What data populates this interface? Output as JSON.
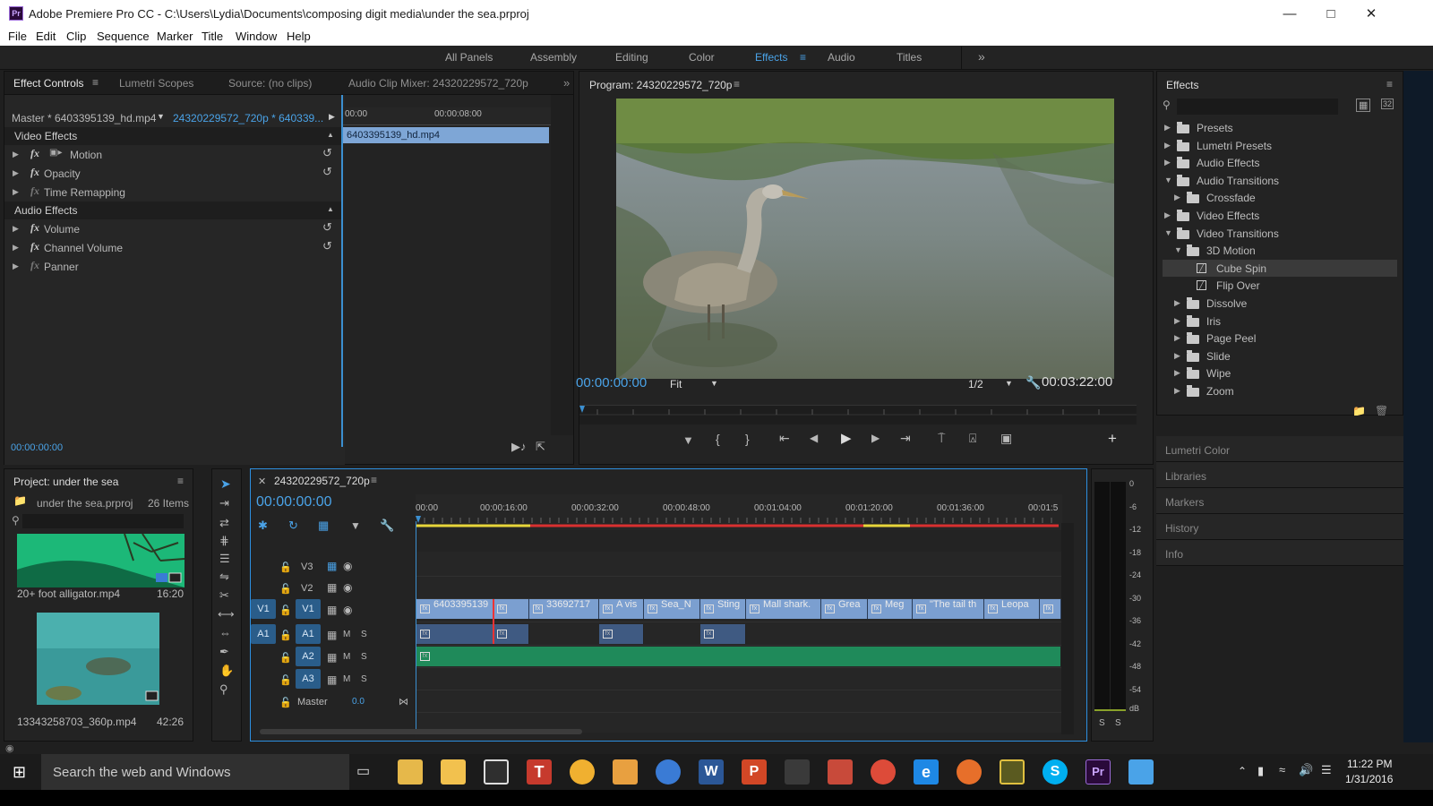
{
  "window": {
    "app_icon": "Pr",
    "title": "Adobe Premiere Pro CC - C:\\Users\\Lydia\\Documents\\composing digit media\\under the sea.prproj",
    "controls": [
      "minimize-icon",
      "maximize-icon",
      "close-icon"
    ]
  },
  "menu": [
    "File",
    "Edit",
    "Clip",
    "Sequence",
    "Marker",
    "Title",
    "Window",
    "Help"
  ],
  "workspaces": {
    "items": [
      "All Panels",
      "Assembly",
      "Editing",
      "Color",
      "Effects",
      "Audio",
      "Titles"
    ],
    "active": "Effects",
    "overflow": "»",
    "menu": "≡"
  },
  "effect_controls": {
    "tabs": [
      "Effect Controls",
      "Lumetri Scopes",
      "Source: (no clips)",
      "Audio Clip Mixer: 24320229572_720p"
    ],
    "overflow": "»",
    "master_label": "Master * 6403395139_hd.mp4",
    "sequence_label": "24320229572_720p * 640339...",
    "ruler": [
      "00:00",
      "00:00:08:00"
    ],
    "clip_bar": "6403395139_hd.mp4",
    "video_section": "Video Effects",
    "video_effects": [
      "Motion",
      "Opacity",
      "Time Remapping"
    ],
    "audio_section": "Audio Effects",
    "audio_effects": [
      "Volume",
      "Channel Volume",
      "Panner"
    ],
    "fx_glyph": "fx",
    "timecode": "00:00:00:00"
  },
  "program": {
    "title": "Program: 24320229572_720p",
    "timecode": "00:00:00:00",
    "zoom": "Fit",
    "resolution": "1/2",
    "duration": "00:03:22:00"
  },
  "effects_panel": {
    "title": "Effects",
    "tree": [
      {
        "label": "Presets",
        "level": 0,
        "expanded": false,
        "type": "star-folder"
      },
      {
        "label": "Lumetri Presets",
        "level": 0,
        "expanded": false,
        "type": "star-folder"
      },
      {
        "label": "Audio Effects",
        "level": 0,
        "expanded": false,
        "type": "folder"
      },
      {
        "label": "Audio Transitions",
        "level": 0,
        "expanded": true,
        "type": "folder"
      },
      {
        "label": "Crossfade",
        "level": 1,
        "expanded": false,
        "type": "folder"
      },
      {
        "label": "Video Effects",
        "level": 0,
        "expanded": false,
        "type": "folder"
      },
      {
        "label": "Video Transitions",
        "level": 0,
        "expanded": true,
        "type": "folder"
      },
      {
        "label": "3D Motion",
        "level": 1,
        "expanded": true,
        "type": "folder"
      },
      {
        "label": "Cube Spin",
        "level": 2,
        "type": "effect",
        "selected": true
      },
      {
        "label": "Flip Over",
        "level": 2,
        "type": "effect"
      },
      {
        "label": "Dissolve",
        "level": 1,
        "expanded": false,
        "type": "folder"
      },
      {
        "label": "Iris",
        "level": 1,
        "expanded": false,
        "type": "folder"
      },
      {
        "label": "Page Peel",
        "level": 1,
        "expanded": false,
        "type": "folder"
      },
      {
        "label": "Slide",
        "level": 1,
        "expanded": false,
        "type": "folder"
      },
      {
        "label": "Wipe",
        "level": 1,
        "expanded": false,
        "type": "folder"
      },
      {
        "label": "Zoom",
        "level": 1,
        "expanded": false,
        "type": "folder"
      }
    ],
    "collapsed_panels": [
      "Lumetri Color",
      "Libraries",
      "Markers",
      "History",
      "Info"
    ]
  },
  "project": {
    "title": "Project: under the sea",
    "file": "under the sea.prproj",
    "count": "26 Items",
    "items": [
      {
        "name": "20+ foot alligator.mp4",
        "duration": "16:20"
      },
      {
        "name": "13343258703_360p.mp4",
        "duration": "42:26"
      }
    ]
  },
  "timeline": {
    "sequence": "24320229572_720p",
    "timecode": "00:00:00:00",
    "ruler": [
      "00:00",
      "00:00:16:00",
      "00:00:32:00",
      "00:00:48:00",
      "00:01:04:00",
      "00:01:20:00",
      "00:01:36:00",
      "00:01:5"
    ],
    "tracks": {
      "video": [
        "V3",
        "V2",
        "V1"
      ],
      "audio": [
        "A1",
        "A2",
        "A3"
      ],
      "source_v": "V1",
      "source_a": "A1",
      "m": "M",
      "s": "S",
      "master": "Master",
      "master_value": "0.0"
    },
    "v1_clips": [
      "6403395139",
      "",
      "33692717",
      "A vis",
      "Sea_N",
      "Sting",
      "Mall shark.",
      "Grea",
      "Meg",
      "\"The tail th",
      "Leopa",
      ""
    ],
    "fx_glyph": "fx"
  },
  "meter": {
    "scale": [
      "0",
      "-6",
      "-12",
      "-18",
      "-24",
      "-30",
      "-36",
      "-42",
      "-48",
      "-54",
      "dB"
    ],
    "solo": [
      "S",
      "S"
    ]
  },
  "taskbar": {
    "search_placeholder": "Search the web and Windows",
    "time": "11:22 PM",
    "date": "1/31/2016"
  },
  "colors": {
    "accent": "#4aa3e8",
    "panel_bg": "#232323",
    "audio_clip": "#1f8a5a",
    "video_clip": "#7b9fd0",
    "taskbar": "#1b1b1b"
  }
}
